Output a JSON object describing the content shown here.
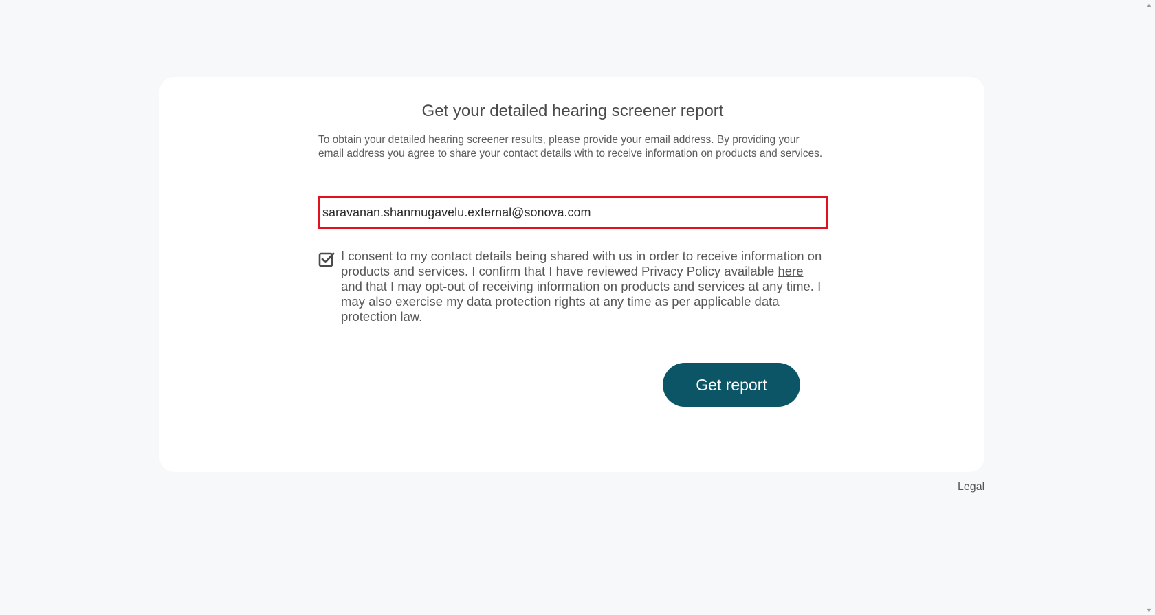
{
  "form": {
    "title": "Get your detailed hearing screener report",
    "intro": "To obtain your detailed hearing screener results, please provide your email address. By providing your email address you agree to share your contact details with to receive information on products and services.",
    "email_value": "saravanan.shanmugavelu.external@sonova.com",
    "email_placeholder": "",
    "consent_checked": true,
    "consent_text_before": "I consent to my contact details being shared with us in order to receive information on products and services. I confirm that I have reviewed Privacy Policy available ",
    "consent_link": "here",
    "consent_text_after": " and that I may opt-out of receiving information on products and services at any time. I may also exercise my data protection rights at any time as per applicable data protection law.",
    "submit_label": "Get report"
  },
  "footer": {
    "legal_label": "Legal"
  },
  "colors": {
    "button_bg": "#0b5566",
    "input_border": "#e0121d",
    "page_bg": "#f7f8f9"
  },
  "icons": {
    "checkbox": "checkbox-checked-icon",
    "scroll_up": "scroll-up-arrow-icon",
    "scroll_down": "scroll-down-arrow-icon"
  }
}
